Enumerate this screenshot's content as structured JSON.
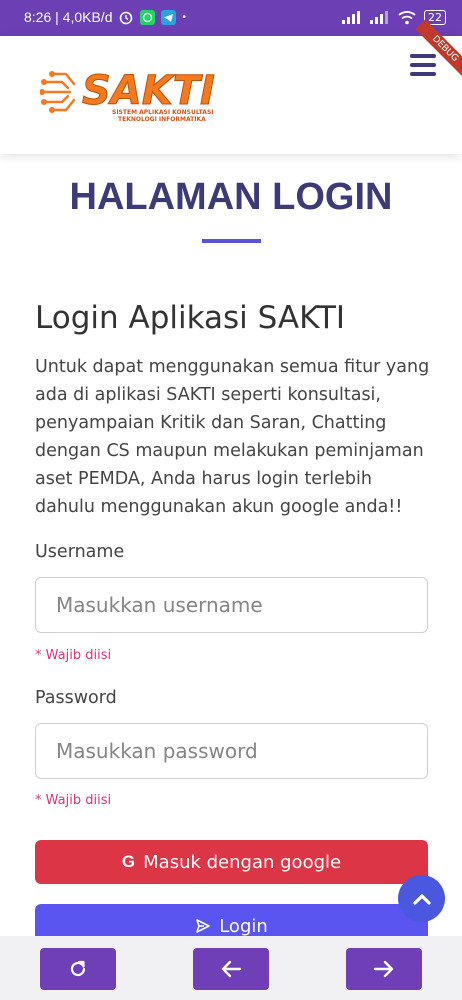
{
  "status_bar": {
    "time_speed": "8:26 | 4,0KB/d",
    "battery": "22"
  },
  "navbar": {
    "logo_text": "SAKTI",
    "logo_tagline_1": "SISTEM APLIKASI KONSULTASI",
    "logo_tagline_2": "TEKNOLOGI INFORMATIKA",
    "ribbon_text": "DEBUG"
  },
  "page": {
    "title": "HALAMAN LOGIN",
    "heading": "Login Aplikasi SAKTI",
    "description": "Untuk dapat menggunakan semua fitur yang ada di aplikasi SAKTI seperti konsultasi, penyampaian Kritik dan Saran, Chatting dengan CS maupun melakukan peminjaman aset PEMDA, Anda harus login terlebih dahulu menggunakan akun google anda!!"
  },
  "form": {
    "username_label": "Username",
    "username_placeholder": "Masukkan username",
    "username_required": "* Wajib diisi",
    "password_label": "Password",
    "password_placeholder": "Masukkan password",
    "password_required": "* Wajib diisi",
    "google_button": "Masuk dengan google",
    "google_icon_glyph": "G",
    "login_button": "Login"
  },
  "colors": {
    "status_bar": "#6d3fb5",
    "title": "#3d3a78",
    "google_button": "#dc3545",
    "login_button": "#5a55f0",
    "required_text": "#d63384",
    "nav_button": "#6e3fb7",
    "logo_orange": "#f47a20"
  },
  "icons": {
    "menu": "hamburger-icon",
    "scroll_top": "chevron-up-icon",
    "refresh": "refresh-icon",
    "back": "arrow-left-icon",
    "forward": "arrow-right-icon"
  }
}
